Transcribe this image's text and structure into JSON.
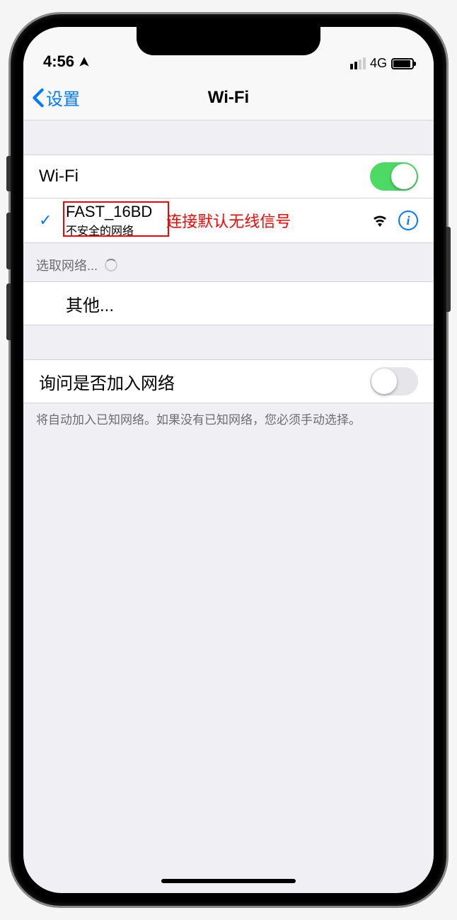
{
  "status": {
    "time": "4:56",
    "network_type": "4G"
  },
  "nav": {
    "back_label": "设置",
    "title": "Wi-Fi"
  },
  "wifi_toggle": {
    "label": "Wi-Fi",
    "enabled": true
  },
  "connected_network": {
    "ssid": "FAST_16BD",
    "security_note": "不安全的网络",
    "annotation": "连接默认无线信号"
  },
  "choose_header": "选取网络...",
  "other_label": "其他...",
  "ask_to_join": {
    "label": "询问是否加入网络",
    "enabled": false
  },
  "footer": "将自动加入已知网络。如果没有已知网络，您必须手动选择。"
}
